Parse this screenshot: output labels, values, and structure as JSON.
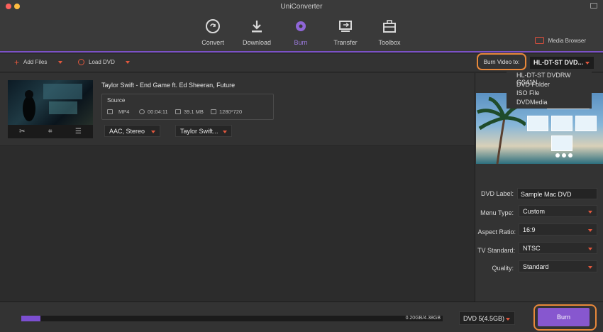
{
  "window": {
    "title": "UniConverter"
  },
  "nav": {
    "items": [
      {
        "label": "Convert",
        "icon": "convert-icon"
      },
      {
        "label": "Download",
        "icon": "download-icon"
      },
      {
        "label": "Burn",
        "icon": "burn-icon",
        "active": true
      },
      {
        "label": "Transfer",
        "icon": "transfer-icon"
      },
      {
        "label": "Toolbox",
        "icon": "toolbox-icon"
      }
    ],
    "media_browser": "Media Browser"
  },
  "toolbar": {
    "add_files": "Add Files",
    "load_dvd": "Load DVD",
    "burn_video_to": "Burn Video to:",
    "burn_target": "HL-DT-ST DVD..."
  },
  "burn_target_options": [
    "HL-DT-ST DVDRW GS41N",
    "DVD Folder",
    "ISO File",
    "DVDMedia"
  ],
  "file": {
    "title": "Taylor Swift - End Game ft. Ed Sheeran, Future",
    "source_label": "Source",
    "format": "MP4",
    "duration": "00:04:11",
    "size": "39.1 MB",
    "resolution": "1280*720",
    "audio": "AAC, Stereo",
    "subtitle": "Taylor Swift..."
  },
  "settings": {
    "dvd_label_label": "DVD Label:",
    "dvd_label_value": "Sample Mac DVD",
    "menu_type_label": "Menu Type:",
    "menu_type_value": "Custom",
    "aspect_ratio_label": "Aspect Ratio:",
    "aspect_ratio_value": "16:9",
    "tv_standard_label": "TV Standard:",
    "tv_standard_value": "NTSC",
    "quality_label": "Quality:",
    "quality_value": "Standard"
  },
  "bottom": {
    "capacity_text": "0.20GB/4.38GB",
    "progress_fraction": 0.046,
    "disc_type": "DVD 5(4.5GB)",
    "burn_label": "Burn"
  },
  "colors": {
    "accent": "#7c4fd1",
    "highlight_ring": "#e8883a",
    "icon_red": "#e0573d"
  }
}
